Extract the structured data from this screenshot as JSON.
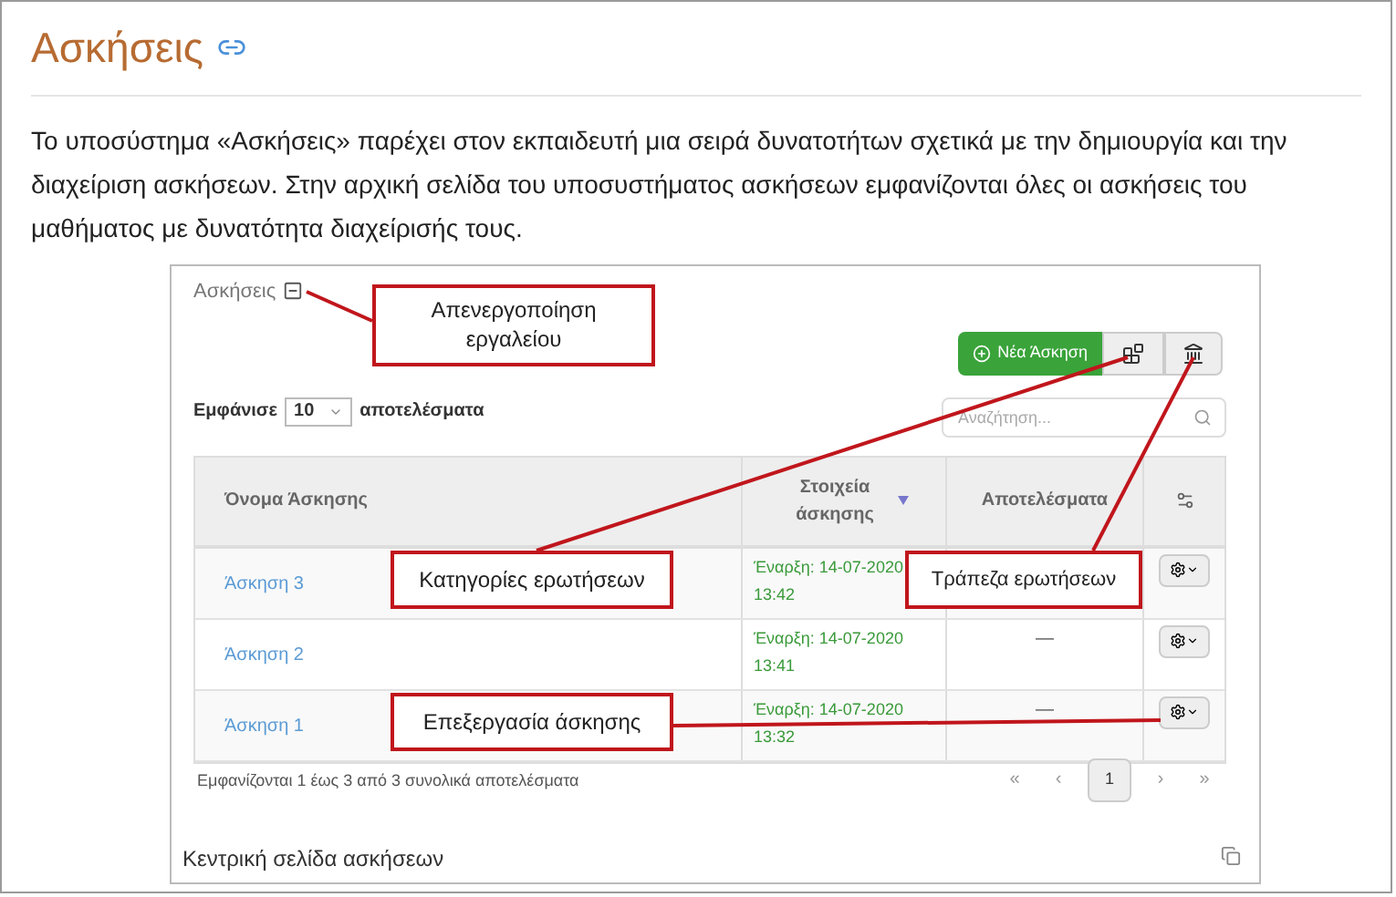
{
  "page": {
    "title": "Ασκήσεις",
    "intro": "Το υποσύστημα «Ασκήσεις» παρέχει στον εκπαιδευτή μια σειρά δυνατοτήτων σχετικά με την δημιουργία και την διαχείριση ασκήσεων. Στην αρχική σελίδα του υποσυστήματος ασκήσεων εμφανίζονται όλες οι ασκήσεις του μαθήματος με δυνατότητα διαχείρισής τους."
  },
  "figure": {
    "tool_title": "Ασκήσεις",
    "new_button": "Νέα Άσκηση",
    "show_label": "Εμφάνισε",
    "page_size": "10",
    "results_label": "αποτελέσματα",
    "search": {
      "placeholder": "Αναζήτηση..."
    },
    "columns": [
      "Όνομα Άσκησης",
      "Στοιχεία άσκησης",
      "Αποτελέσματα"
    ],
    "rows": [
      {
        "name": "Άσκηση 3",
        "start": "Έναρξη: 14-07-2020",
        "time": "13:42"
      },
      {
        "name": "Άσκηση 2",
        "start": "Έναρξη: 14-07-2020",
        "time": "13:41",
        "results": "—"
      },
      {
        "name": "Άσκηση 1",
        "start": "Έναρξη: 14-07-2020",
        "time": "13:32",
        "results": "—"
      }
    ],
    "summary": "Εμφανίζονται 1 έως 3 από 3 συνολικά αποτελέσματα",
    "pagination": [
      {
        "label": "«",
        "selected": false
      },
      {
        "label": "‹",
        "selected": false
      },
      {
        "label": "1",
        "selected": true
      },
      {
        "label": "›",
        "selected": false
      },
      {
        "label": "»",
        "selected": false
      }
    ],
    "caption": "Κεντρική σελίδα ασκήσεων",
    "callouts": [
      "Απενεργοποίηση εργαλείου",
      "Κατηγορίες ερωτήσεων",
      "Τράπεζα ερωτήσεων",
      "Επεξεργασία άσκησης"
    ]
  }
}
